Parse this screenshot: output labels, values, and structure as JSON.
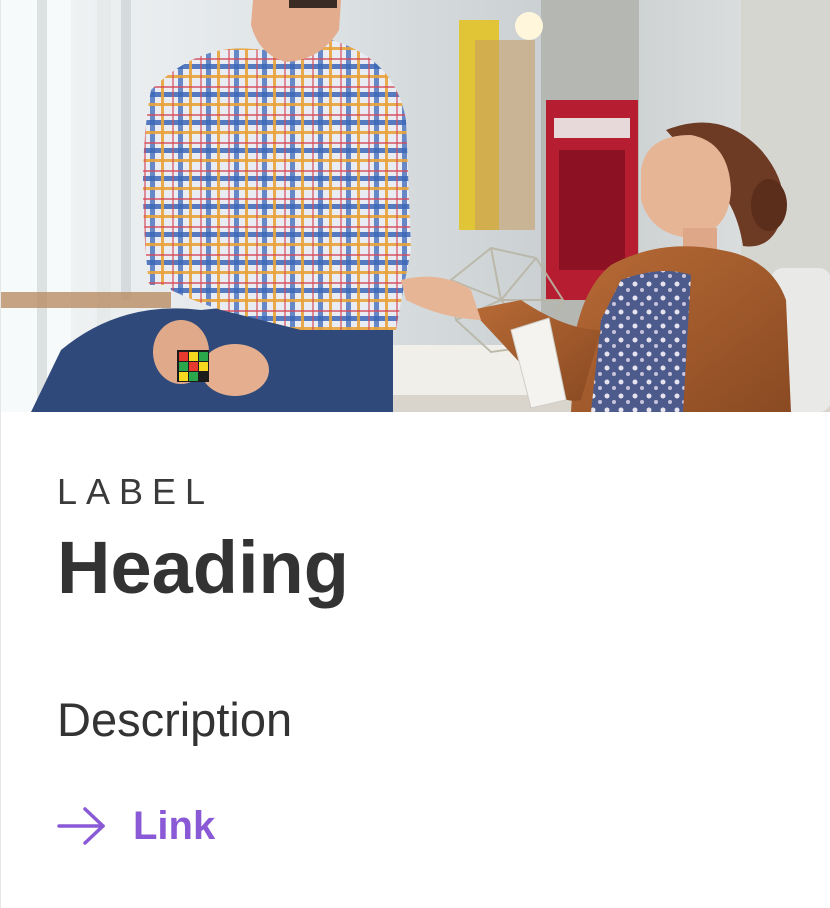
{
  "card": {
    "label": "LABEL",
    "heading": "Heading",
    "description": "Description",
    "link_label": "Link"
  },
  "colors": {
    "accent": "#8a5ad6",
    "text": "#333333",
    "background": "#ffffff"
  },
  "icons": {
    "link_icon": "arrow-right-icon"
  }
}
